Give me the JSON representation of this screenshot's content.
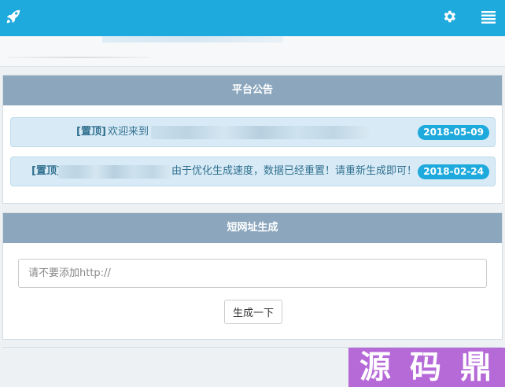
{
  "header": {
    "logo_icon": "rocket-icon",
    "settings_icon": "gear-icon",
    "menu_icon": "list-icon",
    "color": "#1eaadc"
  },
  "notice_panel": {
    "title": "平台公告",
    "items": [
      {
        "tag": "[置顶]",
        "text": "欢迎来到",
        "date": "2018-05-09"
      },
      {
        "tag": "[置顶]",
        "text": "由于优化生成速度，数据已经重置！请重新生成即可！",
        "date": "2018-02-24"
      }
    ]
  },
  "generator_panel": {
    "title": "短网址生成",
    "input_placeholder": "请不要添加http://",
    "input_value": "",
    "button_label": "生成一下"
  },
  "watermark": {
    "chars": [
      "源",
      "码",
      "鼎"
    ],
    "color": "#b66ad8"
  }
}
